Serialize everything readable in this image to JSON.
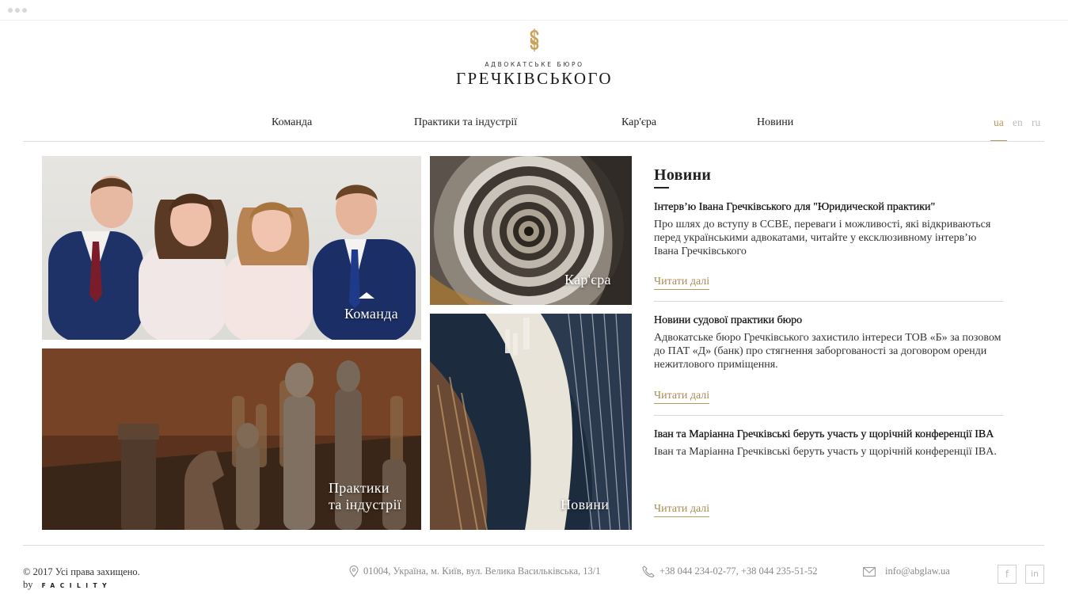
{
  "logo": {
    "subtitle": "АДВОКАТСЬКЕ БЮРО",
    "name": "ГРЕЧКІВСЬКОГО",
    "accent_color": "#c9a25e"
  },
  "nav": {
    "items": [
      {
        "label": "Команда"
      },
      {
        "label": "Практики та індустрії"
      },
      {
        "label": "Кар'єра"
      },
      {
        "label": "Новини"
      }
    ],
    "languages": [
      {
        "code": "ua",
        "active": true
      },
      {
        "code": "en",
        "active": false
      },
      {
        "code": "ru",
        "active": false
      }
    ]
  },
  "tiles": {
    "team": "Команда",
    "career": "Кар'єра",
    "practices_line1": "Практики",
    "practices_line2": "та індустрії",
    "news": "Новини"
  },
  "news": {
    "heading": "Новини",
    "articles": [
      {
        "title": "Інтерв’ю Івана Гречківського для \"Юридической практики\"",
        "body": "Про шлях до вступу в ССВЕ, переваги і можливості, які відкриваються перед українськими адвокатами, читайте у ексклюзивному інтерв’ю Івана Гречківського",
        "more": "Читати далі"
      },
      {
        "title": "Новини судової практики бюро",
        "body": "Адвокатське бюро Гречківського захистило інтереси ТОВ «Б» за позовом до ПАТ «Д» (банк) про стягнення заборгованості за договором оренди нежитлового приміщення.",
        "more": "Читати далі"
      },
      {
        "title": "Іван та Маріанна Гречківські беруть участь у щорічній конференції IBA",
        "body": "Іван та Маріанна Гречківські беруть участь у щорічній конференції IBA.",
        "more": "Читати далі"
      }
    ]
  },
  "footer": {
    "copyright": "© 2017 Усі права захищено.",
    "by": "by",
    "developer": "FACILITY",
    "address": "01004, Україна, м. Київ, вул. Велика Васильківська, 13/1",
    "phones": "+38 044 234-02-77, +38 044 235-51-52",
    "email": "info@abglaw.ua",
    "social": {
      "facebook": "f",
      "linkedin": "in"
    }
  },
  "colors": {
    "gold": "#b79a5e",
    "text": "#222222",
    "muted": "#bdbdbd"
  }
}
